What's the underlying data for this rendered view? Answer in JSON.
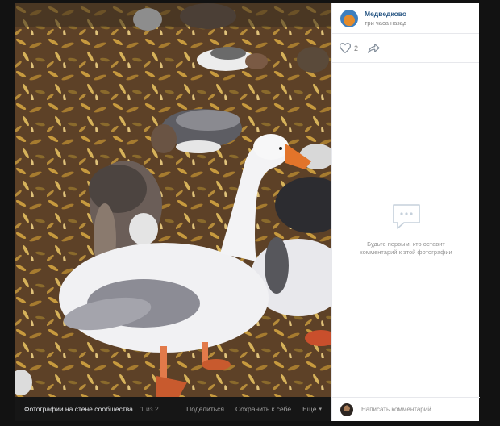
{
  "post": {
    "author": "Медведково",
    "time": "три часа назад",
    "likes": "2"
  },
  "photo_bar": {
    "album": "Фотографии на стене сообщества",
    "counter": "1 из 2",
    "share": "Поделиться",
    "save": "Сохранить к себе",
    "more": "Ещё"
  },
  "comments": {
    "empty_message": "Будьте первым, кто оставит комментарий к этой фотографии",
    "placeholder": "Написать комментарий..."
  },
  "icons": {
    "like": "heart-icon",
    "share": "share-arrow-icon",
    "empty": "chat-bubble-icon",
    "more": "chevron-down-icon"
  },
  "colors": {
    "author_link": "#2a5885",
    "muted": "#828282",
    "viewer_bg": "#1f1f1f"
  }
}
